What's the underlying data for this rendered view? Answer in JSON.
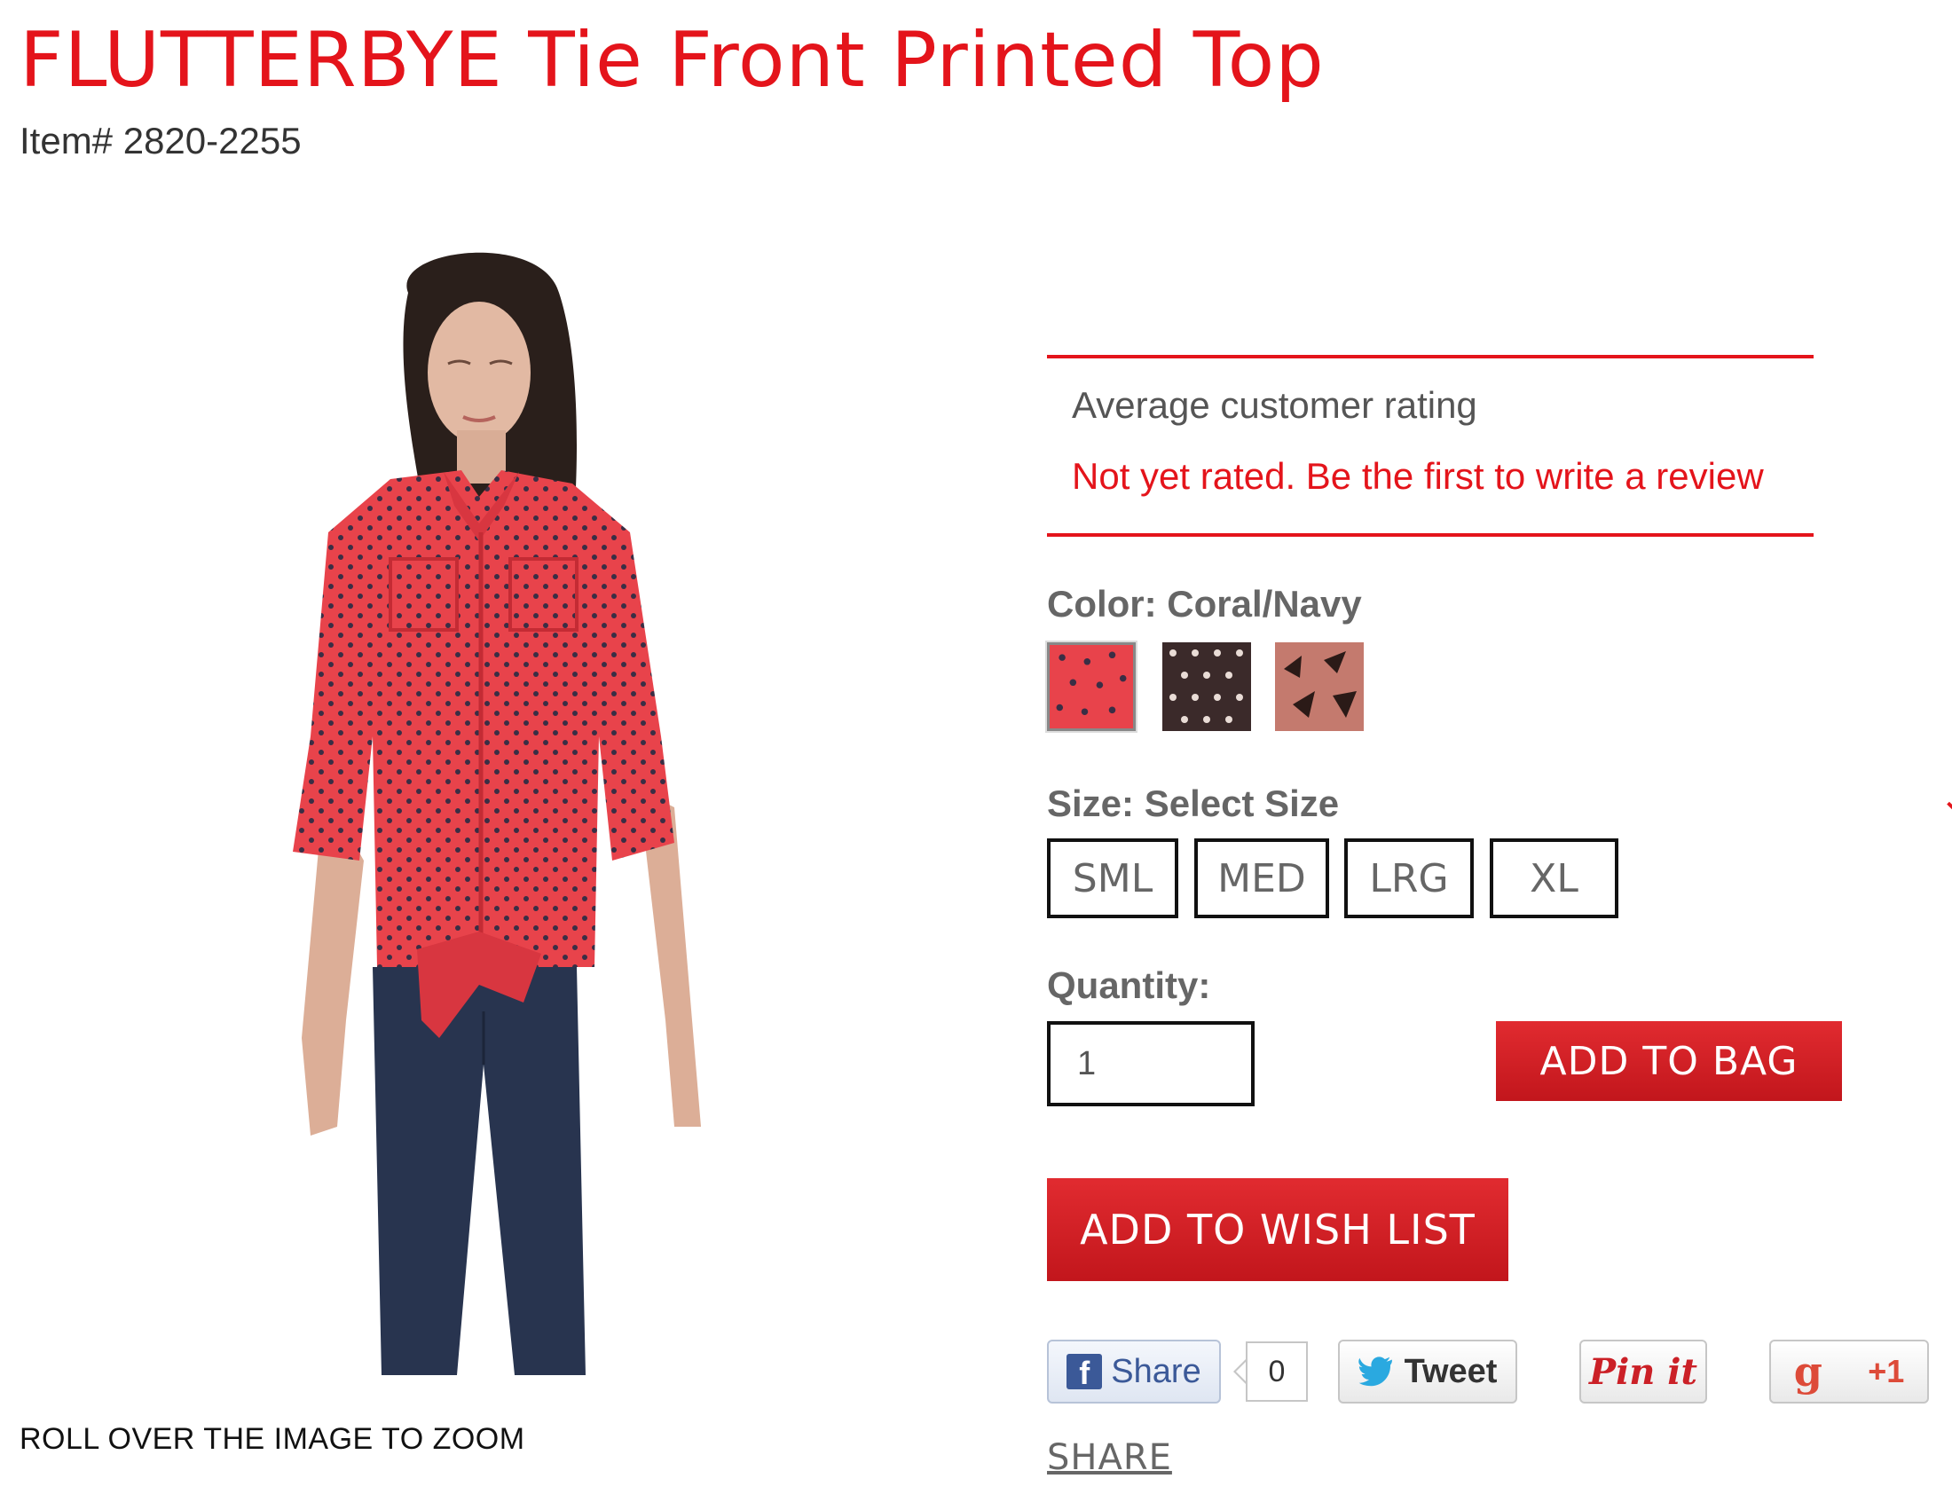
{
  "product": {
    "title": "FLUTTERBYE Tie Front Printed Top",
    "item_number": "Item# 2820-2255",
    "image_hint": "ROLL OVER THE IMAGE TO ZOOM"
  },
  "rating": {
    "heading": "Average customer rating",
    "status": "Not yet rated. Be the first to write a review"
  },
  "color": {
    "label": "Color: Coral/Navy",
    "swatches": [
      {
        "name": "Coral/Navy",
        "selected": true
      },
      {
        "name": "Brown dot",
        "selected": false
      },
      {
        "name": "Pink butterfly",
        "selected": false
      }
    ]
  },
  "size": {
    "label": "Size: Select Size",
    "options": [
      "SML",
      "MED",
      "LRG",
      "XL"
    ]
  },
  "quantity": {
    "label": "Quantity:",
    "value": "1"
  },
  "actions": {
    "add_to_bag": "ADD TO BAG",
    "add_to_wish_list": "ADD TO WISH LIST"
  },
  "social": {
    "facebook_label": "Share",
    "facebook_count": "0",
    "twitter_label": "Tweet",
    "pinterest_label": "Pin it",
    "google_label": "+1",
    "share_link": "SHARE"
  },
  "colors": {
    "brand_red": "#e4141b",
    "button_red": "#c2161c",
    "coral": "#e8434b",
    "navy": "#2b2f4a"
  }
}
